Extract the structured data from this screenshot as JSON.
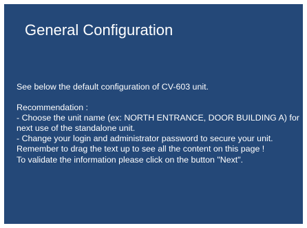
{
  "title": "General Configuration",
  "intro": "See below the default configuration of CV-603 unit.",
  "recommendation": {
    "heading": "Recommendation :",
    "lines": [
      " - Choose the unit name (ex: NORTH ENTRANCE, DOOR BUILDING A) for next use of the standalone unit.",
      "- Change your login and administrator password to secure your unit.",
      "Remember to drag the text up to see all the content on this page !",
      "To validate the information please click on the button \"Next\"."
    ]
  },
  "colors": {
    "background": "#244878",
    "text": "#ffffff"
  }
}
